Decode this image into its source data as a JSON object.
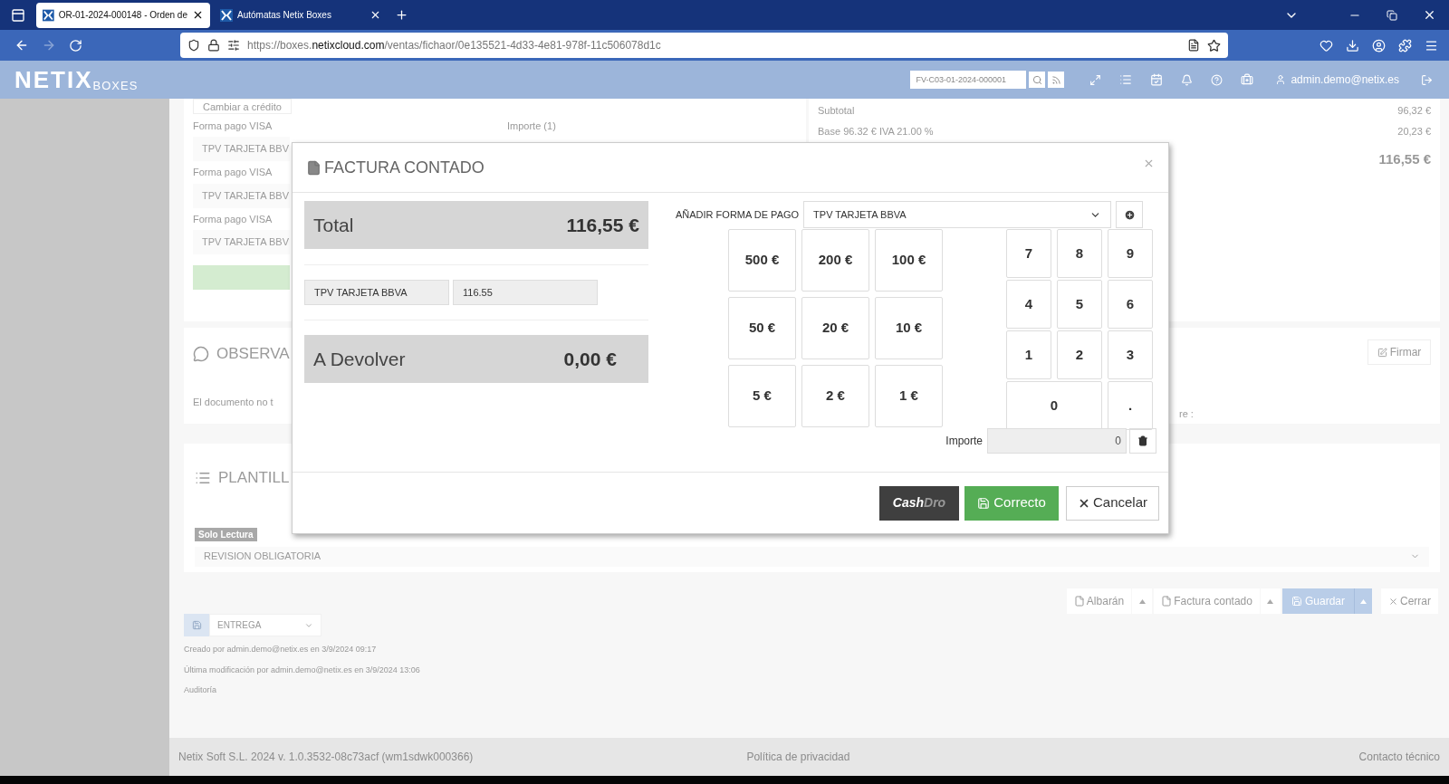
{
  "browser": {
    "tabs": [
      {
        "title": "OR-01-2024-000148 - Orden de",
        "selected": true
      },
      {
        "title": "Autómatas Netix Boxes",
        "selected": false
      }
    ],
    "nav": {
      "back_disabled": false,
      "forward_disabled": true
    },
    "url": {
      "host_prefix": "https://boxes.",
      "host": "netixcloud.com",
      "path": "/ventas/fichaor/0e135521-4d33-4e81-978f-11c506078d1c"
    }
  },
  "header": {
    "logo": "NETIX",
    "logo_sub": "BOXES",
    "search": {
      "placeholder": "FV-C03-01-2024-000001"
    },
    "user": "admin.demo@netix.es"
  },
  "payments_card": {
    "change_button": "Cambiar a crédito",
    "amount_label": "Importe (1)",
    "rows": [
      {
        "label": "Forma pago VISA",
        "value": "TPV TARJETA BBV"
      },
      {
        "label": "Forma pago VISA",
        "value": "TPV TARJETA BBV"
      },
      {
        "label": "Forma pago VISA",
        "value": "TPV TARJETA BBV"
      }
    ]
  },
  "totals_card": {
    "rows": [
      {
        "label": "Subtotal",
        "value": "96,32 €"
      },
      {
        "label": "Base 96.32 € IVA 21.00 %",
        "value": "20,23 €"
      }
    ],
    "total": "116,55 €"
  },
  "observations_card": {
    "title": "OBSERVA",
    "text": "El documento no t"
  },
  "sign_card": {
    "button": "Firmar",
    "text": "re :"
  },
  "template_card": {
    "title": "PLANTILL",
    "badge": "Solo Lectura",
    "select": "REVISION OBLIGATORIA"
  },
  "actions": [
    {
      "label": "Albarán",
      "kind": "doc"
    },
    {
      "kind": "caret"
    },
    {
      "label": "Factura contado",
      "kind": "doc"
    },
    {
      "kind": "caret"
    },
    {
      "label": "Guardar",
      "kind": "primary"
    },
    {
      "kind": "primary-caret"
    },
    {
      "label": "Cerrar",
      "kind": "close"
    }
  ],
  "status_select": "ENTREGA",
  "audit": [
    "Creado por admin.demo@netix.es en 3/9/2024 09:17",
    "Última modificación por admin.demo@netix.es en 3/9/2024 13:06",
    "Auditoría"
  ],
  "footer": {
    "left": "Netix Soft S.L. 2024 v. 1.0.3532-08c73acf (wm1sdwk000366)",
    "center": "Política de privacidad",
    "right": "Contacto técnico"
  },
  "modal": {
    "title": "FACTURA CONTADO",
    "total_label": "Total",
    "total": "116,55 €",
    "payment_lines": [
      {
        "method": "TPV TARJETA BBVA",
        "amount": "116.55"
      }
    ],
    "change_label": "A Devolver",
    "change": "0,00 €",
    "add_label": "AÑADIR FORMA DE PAGO",
    "add_select": "TPV TARJETA BBVA",
    "bills": [
      "500 €",
      "200 €",
      "100 €",
      "50 €",
      "20 €",
      "10 €",
      "5 €",
      "2 €",
      "1 €"
    ],
    "keys": [
      {
        "label": "7",
        "kind": "key"
      },
      {
        "label": "8",
        "kind": "key"
      },
      {
        "label": "9",
        "kind": "key"
      },
      {
        "label": "4",
        "kind": "key"
      },
      {
        "label": "5",
        "kind": "key"
      },
      {
        "label": "6",
        "kind": "key"
      },
      {
        "label": "1",
        "kind": "key"
      },
      {
        "label": "2",
        "kind": "key"
      },
      {
        "label": "3",
        "kind": "key"
      },
      {
        "label": "0",
        "kind": "wide"
      },
      {
        "label": ".",
        "kind": "key"
      }
    ],
    "amount_label": "Importe",
    "amount": "0",
    "cashdro": {
      "part1": "Cash",
      "part2": "Dro"
    },
    "ok": "Correcto",
    "cancel": "Cancelar"
  }
}
